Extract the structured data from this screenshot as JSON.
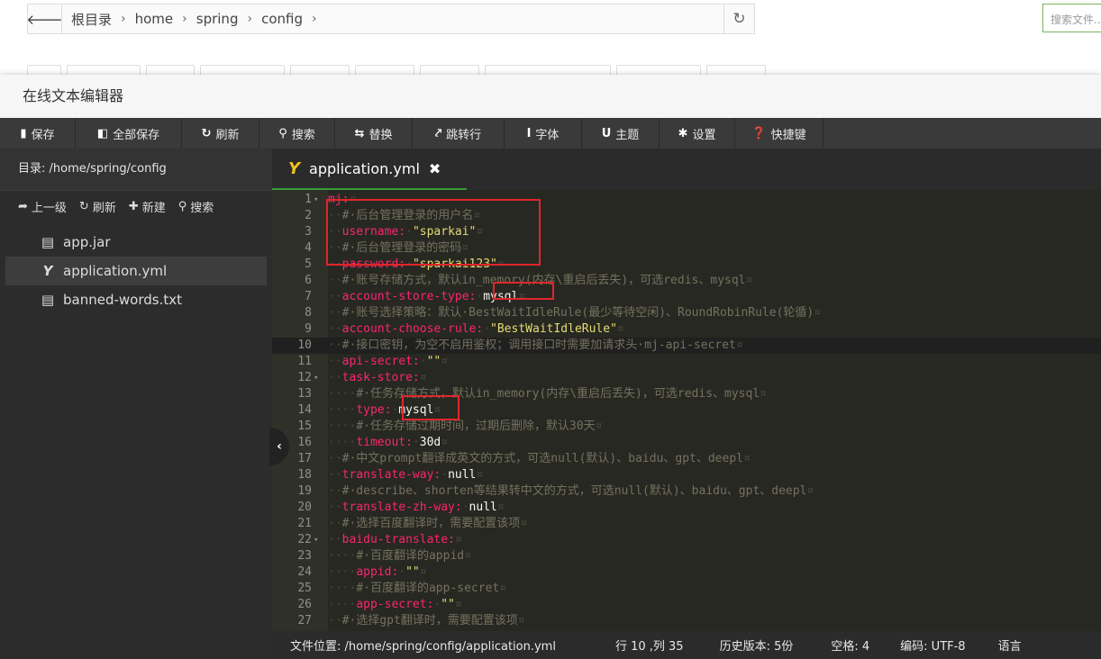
{
  "browser": {
    "back_icon": "arrow-left-icon",
    "breadcrumbs": [
      "根目录",
      "home",
      "spring",
      "config"
    ],
    "refresh_icon": "refresh-icon",
    "search_placeholder": "搜索文件..."
  },
  "dialog": {
    "title": "在线文本编辑器"
  },
  "toolbar": {
    "buttons": [
      {
        "icon": "save-icon",
        "glyph": "▮",
        "label": "保存"
      },
      {
        "icon": "save-all-icon",
        "glyph": "◧",
        "label": "全部保存"
      },
      {
        "icon": "refresh-icon",
        "glyph": "↻",
        "label": "刷新"
      },
      {
        "icon": "search-icon",
        "glyph": "⚲",
        "label": "搜索"
      },
      {
        "icon": "replace-icon",
        "glyph": "⇆",
        "label": "替换"
      },
      {
        "icon": "pin-icon",
        "glyph": "⤤",
        "label": "跳转行"
      },
      {
        "icon": "font-icon",
        "glyph": "I",
        "label": "字体"
      },
      {
        "icon": "theme-icon",
        "glyph": "U",
        "label": "主题"
      },
      {
        "icon": "gear-icon",
        "glyph": "✱",
        "label": "设置"
      },
      {
        "icon": "help-icon",
        "glyph": "❓",
        "label": "快捷键"
      }
    ]
  },
  "sidebar": {
    "path_label": "目录: /home/spring/config",
    "actions": [
      {
        "icon": "arrow-up-icon",
        "glyph": "➦",
        "label": "上一级"
      },
      {
        "icon": "refresh-icon",
        "glyph": "↻",
        "label": "刷新"
      },
      {
        "icon": "plus-icon",
        "glyph": "✚",
        "label": "新建"
      },
      {
        "icon": "search-icon",
        "glyph": "⚲",
        "label": "搜索"
      }
    ],
    "files": [
      {
        "name": "app.jar",
        "icon": "file-icon",
        "glyph": "▤",
        "active": false
      },
      {
        "name": "application.yml",
        "icon": "yaml-icon",
        "glyph": "Y",
        "active": true
      },
      {
        "name": "banned-words.txt",
        "icon": "file-icon",
        "glyph": "▤",
        "active": false
      }
    ]
  },
  "tab": {
    "icon": "yaml-icon",
    "label": "application.yml",
    "close_icon": "close-icon"
  },
  "editor": {
    "current_line": 10,
    "lines": [
      {
        "n": "1",
        "fold": true,
        "parts": [
          [
            "k",
            "mj:"
          ],
          [
            "w",
            "¤"
          ]
        ]
      },
      {
        "n": "2",
        "parts": [
          [
            "w",
            "··"
          ],
          [
            "c",
            "#·后台管理登录的用户名"
          ],
          [
            "w",
            "¤"
          ]
        ]
      },
      {
        "n": "3",
        "parts": [
          [
            "w",
            "··"
          ],
          [
            "k",
            "username:"
          ],
          [
            "w",
            "·"
          ],
          [
            "s",
            "\"sparkai\""
          ],
          [
            "w",
            "¤"
          ]
        ]
      },
      {
        "n": "4",
        "parts": [
          [
            "w",
            "··"
          ],
          [
            "c",
            "#·后台管理登录的密码"
          ],
          [
            "w",
            "¤"
          ]
        ]
      },
      {
        "n": "5",
        "parts": [
          [
            "w",
            "··"
          ],
          [
            "k",
            "password:"
          ],
          [
            "w",
            "·"
          ],
          [
            "s",
            "\"sparkai123\""
          ],
          [
            "w",
            "¤"
          ]
        ]
      },
      {
        "n": "6",
        "parts": [
          [
            "w",
            "··"
          ],
          [
            "c",
            "#·账号存储方式，默认in_memory(内存\\重启后丢失)，可选redis、mysql"
          ],
          [
            "w",
            "¤"
          ]
        ]
      },
      {
        "n": "7",
        "parts": [
          [
            "w",
            "··"
          ],
          [
            "k",
            "account-store-type:"
          ],
          [
            "w",
            "·"
          ],
          [
            "p",
            "mysql"
          ],
          [
            "w",
            "¤"
          ]
        ]
      },
      {
        "n": "8",
        "parts": [
          [
            "w",
            "··"
          ],
          [
            "c",
            "#·账号选择策略：默认·BestWaitIdleRule(最少等待空闲)、RoundRobinRule(轮循)"
          ],
          [
            "w",
            "¤"
          ]
        ]
      },
      {
        "n": "9",
        "parts": [
          [
            "w",
            "··"
          ],
          [
            "k",
            "account-choose-rule:"
          ],
          [
            "w",
            "·"
          ],
          [
            "s",
            "\"BestWaitIdleRule\""
          ],
          [
            "w",
            "¤"
          ]
        ]
      },
      {
        "n": "10",
        "parts": [
          [
            "w",
            "··"
          ],
          [
            "c",
            "#·接口密钥，为空不启用鉴权；调用接口时需要加请求头·mj-api-secret"
          ],
          [
            "w",
            "¤"
          ]
        ]
      },
      {
        "n": "11",
        "parts": [
          [
            "w",
            "··"
          ],
          [
            "k",
            "api-secret:"
          ],
          [
            "w",
            "·"
          ],
          [
            "s",
            "\"\""
          ],
          [
            "w",
            "¤"
          ]
        ]
      },
      {
        "n": "12",
        "fold": true,
        "parts": [
          [
            "w",
            "··"
          ],
          [
            "k",
            "task-store:"
          ],
          [
            "w",
            "¤"
          ]
        ]
      },
      {
        "n": "13",
        "parts": [
          [
            "w",
            "····"
          ],
          [
            "c",
            "#·任务存储方式，默认in_memory(内存\\重启后丢失)，可选redis、mysql"
          ],
          [
            "w",
            "¤"
          ]
        ]
      },
      {
        "n": "14",
        "parts": [
          [
            "w",
            "····"
          ],
          [
            "k",
            "type:"
          ],
          [
            "w",
            "·"
          ],
          [
            "p",
            "mysql"
          ],
          [
            "w",
            "¤"
          ]
        ]
      },
      {
        "n": "15",
        "parts": [
          [
            "w",
            "····"
          ],
          [
            "c",
            "#·任务存储过期时间，过期后删除，默认30天"
          ],
          [
            "w",
            "¤"
          ]
        ]
      },
      {
        "n": "16",
        "parts": [
          [
            "w",
            "····"
          ],
          [
            "k",
            "timeout:"
          ],
          [
            "w",
            "·"
          ],
          [
            "p",
            "30d"
          ],
          [
            "w",
            "¤"
          ]
        ]
      },
      {
        "n": "17",
        "parts": [
          [
            "w",
            "··"
          ],
          [
            "c",
            "#·中文prompt翻译成英文的方式，可选null(默认)、baidu、gpt、deepl"
          ],
          [
            "w",
            "¤"
          ]
        ]
      },
      {
        "n": "18",
        "parts": [
          [
            "w",
            "··"
          ],
          [
            "k",
            "translate-way:"
          ],
          [
            "w",
            "·"
          ],
          [
            "p",
            "null"
          ],
          [
            "w",
            "¤"
          ]
        ]
      },
      {
        "n": "19",
        "parts": [
          [
            "w",
            "··"
          ],
          [
            "c",
            "#·describe、shorten等结果转中文的方式，可选null(默认)、baidu、gpt、deepl"
          ],
          [
            "w",
            "¤"
          ]
        ]
      },
      {
        "n": "20",
        "parts": [
          [
            "w",
            "··"
          ],
          [
            "k",
            "translate-zh-way:"
          ],
          [
            "w",
            "·"
          ],
          [
            "p",
            "null"
          ],
          [
            "w",
            "¤"
          ]
        ]
      },
      {
        "n": "21",
        "parts": [
          [
            "w",
            "··"
          ],
          [
            "c",
            "#·选择百度翻译时，需要配置该项"
          ],
          [
            "w",
            "¤"
          ]
        ]
      },
      {
        "n": "22",
        "fold": true,
        "parts": [
          [
            "w",
            "··"
          ],
          [
            "k",
            "baidu-translate:"
          ],
          [
            "w",
            "¤"
          ]
        ]
      },
      {
        "n": "23",
        "parts": [
          [
            "w",
            "····"
          ],
          [
            "c",
            "#·百度翻译的appid"
          ],
          [
            "w",
            "¤"
          ]
        ]
      },
      {
        "n": "24",
        "parts": [
          [
            "w",
            "····"
          ],
          [
            "k",
            "appid:"
          ],
          [
            "w",
            "·"
          ],
          [
            "s",
            "\"\""
          ],
          [
            "w",
            "¤"
          ]
        ]
      },
      {
        "n": "25",
        "parts": [
          [
            "w",
            "····"
          ],
          [
            "c",
            "#·百度翻译的app-secret"
          ],
          [
            "w",
            "¤"
          ]
        ]
      },
      {
        "n": "26",
        "parts": [
          [
            "w",
            "····"
          ],
          [
            "k",
            "app-secret:"
          ],
          [
            "w",
            "·"
          ],
          [
            "s",
            "\"\""
          ],
          [
            "w",
            "¤"
          ]
        ]
      },
      {
        "n": "27",
        "parts": [
          [
            "w",
            "··"
          ],
          [
            "c",
            "#·选择gpt翻译时，需要配置该项"
          ],
          [
            "w",
            "¤"
          ]
        ]
      }
    ]
  },
  "status": {
    "file_location": "文件位置: /home/spring/config/application.yml",
    "cursor": "行 10 ,列 35",
    "history": "历史版本: 5份",
    "indent": "空格: 4",
    "encoding": "编码: UTF-8",
    "language": "语言"
  },
  "colors": {
    "toolbar_bg": "#3a3a3a",
    "sidebar_bg": "#2c2c2c",
    "editor_bg": "#272822",
    "key": "#f92672",
    "string": "#e6db74",
    "comment": "#75715e",
    "highlight_box": "#e0262b",
    "tab_underline": "#3a9a3a"
  }
}
